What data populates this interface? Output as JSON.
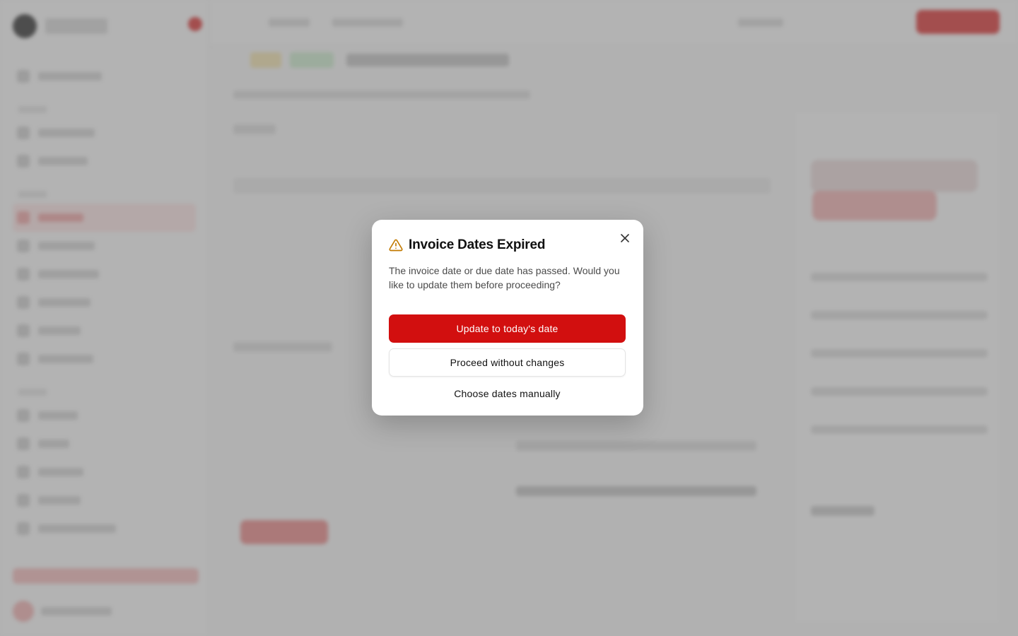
{
  "modal": {
    "title": "Invoice Dates Expired",
    "description": "The invoice date or due date has passed. Would you like to update them before proceeding?",
    "actions": {
      "update_label": "Update to today's date",
      "proceed_label": "Proceed without changes",
      "choose_label": "Choose dates manually"
    },
    "icons": {
      "header": "warning-icon",
      "close": "close-icon"
    }
  },
  "colors": {
    "accent": "#d20f0f",
    "warning": "#c27a00",
    "overlay": "rgba(120,120,120,0.55)"
  }
}
